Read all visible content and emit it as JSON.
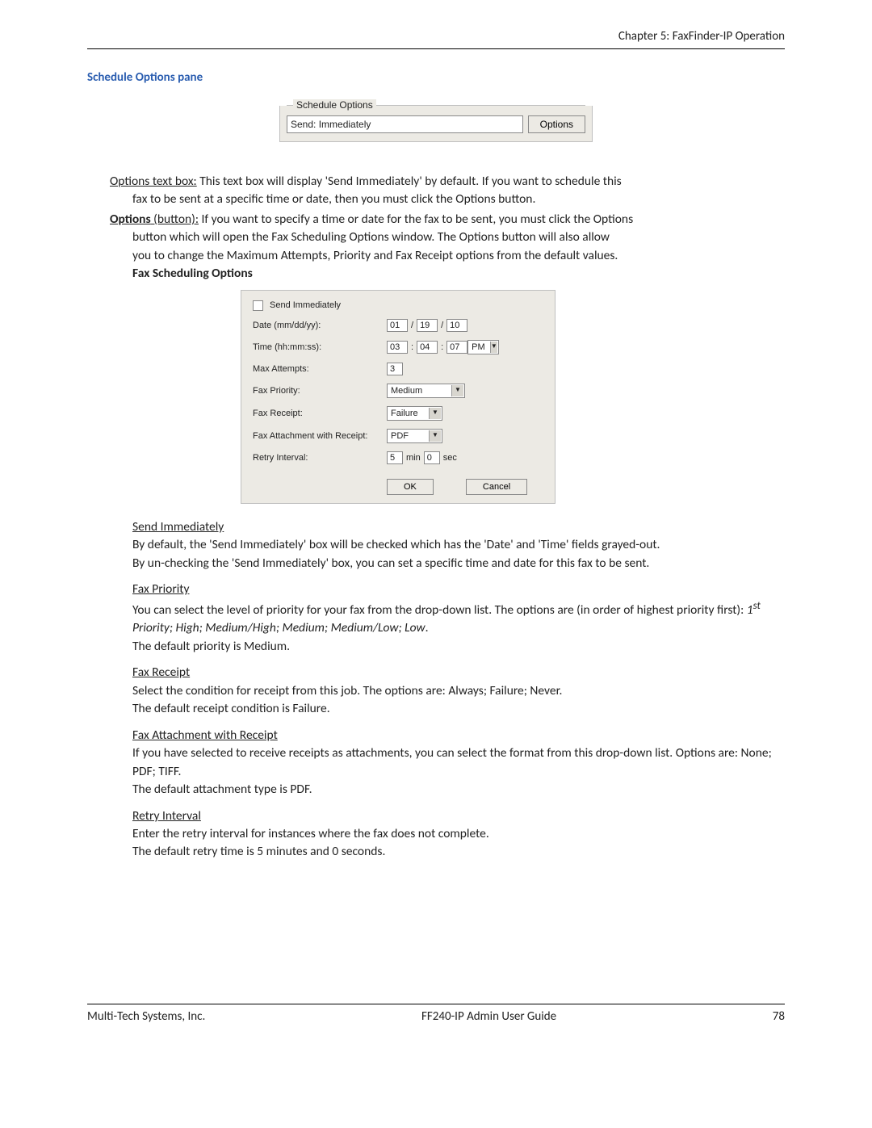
{
  "header": {
    "chapter": "Chapter 5: FaxFinder-IP Operation"
  },
  "section": {
    "title": "Schedule Options pane"
  },
  "pane": {
    "legend": "Schedule Options",
    "send_value": "Send: Immediately",
    "options_btn": "Options"
  },
  "p1": {
    "lead": "Options text box:",
    "rest1": " This text box will display 'Send Immediately' by default. If you want to schedule this",
    "rest2": "fax to be sent at a specific time or date, then you must click the Options button."
  },
  "p2": {
    "lead": "Options",
    "lead2": " (button):",
    "rest1": " If you want to specify a time or date for the fax to be sent, you must click the Options",
    "rest2": "button which will open the Fax Scheduling Options window. The Options button will also allow",
    "rest3": "you to change the Maximum Attempts, Priority and Fax Receipt options from the default values.",
    "subhead": "Fax Scheduling Options"
  },
  "sched": {
    "send_immediately_label": "Send Immediately",
    "date_label": "Date (mm/dd/yy):",
    "date_mm": "01",
    "date_dd": "19",
    "date_yy": "10",
    "time_label": "Time (hh:mm:ss):",
    "time_hh": "03",
    "time_mm": "04",
    "time_ss": "07",
    "time_ampm": "PM",
    "max_attempts_label": "Max Attempts:",
    "max_attempts": "3",
    "priority_label": "Fax Priority:",
    "priority": "Medium",
    "receipt_label": "Fax Receipt:",
    "receipt": "Failure",
    "attach_label": "Fax Attachment with Receipt:",
    "attach": "PDF",
    "retry_label": "Retry Interval:",
    "retry_min": "5",
    "retry_min_unit": "min",
    "retry_sec": "0",
    "retry_sec_unit": "sec",
    "ok": "OK",
    "cancel": "Cancel"
  },
  "desc": {
    "si_head": "Send Immediately",
    "si_1": "By default, the 'Send Immediately' box will be checked which has the 'Date' and 'Time' fields grayed-out.",
    "si_2": "By un-checking the 'Send Immediately' box, you can set a specific time and date for this fax to be sent.",
    "fp_head": "Fax Priority",
    "fp_1": "You can select the level of priority for your fax from the drop-down list. The options are (in order of highest priority first): ",
    "fp_italic": "1st Priority; High; Medium/High; Medium; Medium/Low; Low",
    "fp_1_end": ".",
    "fp_2": "The default priority is Medium.",
    "fr_head": "Fax Receipt",
    "fr_1": "Select the condition for receipt from this job. The options are: Always; Failure; Never.",
    "fr_2": "The default receipt condition is Failure.",
    "fa_head": "Fax Attachment with Receipt",
    "fa_1": "If you have selected to receive receipts as attachments, you can select the format from this drop-down list. Options are: None; PDF; TIFF.",
    "fa_2": "The default attachment type is PDF.",
    "ri_head": "Retry Interval",
    "ri_1": "Enter the retry interval for instances where the fax does not complete.",
    "ri_2": "The default retry time is 5 minutes and 0 seconds."
  },
  "footer": {
    "left": "Multi-Tech Systems, Inc.",
    "center": "FF240-IP Admin User Guide",
    "right": "78"
  }
}
